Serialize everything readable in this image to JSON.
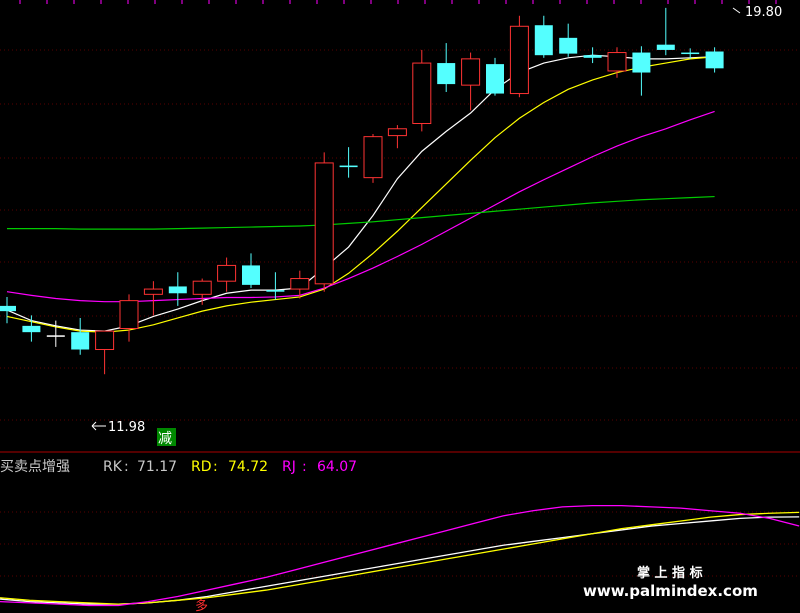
{
  "chart_data": [
    {
      "type": "candlestick",
      "title": "",
      "xlabel": "",
      "ylabel": "",
      "ylim": [
        11.5,
        20.1
      ],
      "grid": true,
      "annotations": {
        "high_label": "19.80",
        "low_label": "11.98",
        "signal_label": "减"
      },
      "candles": [
        {
          "o": 14.18,
          "h": 14.45,
          "l": 13.95,
          "c": 14.28,
          "color": "cyan"
        },
        {
          "o": 13.9,
          "h": 14.1,
          "l": 13.6,
          "c": 13.78,
          "color": "cyan"
        },
        {
          "o": 13.7,
          "h": 14.0,
          "l": 13.5,
          "c": 13.72,
          "color": "white"
        },
        {
          "o": 13.78,
          "h": 14.05,
          "l": 13.35,
          "c": 13.45,
          "color": "cyan"
        },
        {
          "o": 13.45,
          "h": 13.78,
          "l": 12.98,
          "c": 13.8,
          "color": "red"
        },
        {
          "o": 13.85,
          "h": 14.5,
          "l": 13.6,
          "c": 14.38,
          "color": "red"
        },
        {
          "o": 14.5,
          "h": 14.75,
          "l": 14.1,
          "c": 14.6,
          "color": "red"
        },
        {
          "o": 14.65,
          "h": 14.92,
          "l": 14.28,
          "c": 14.52,
          "color": "cyan"
        },
        {
          "o": 14.5,
          "h": 14.8,
          "l": 14.3,
          "c": 14.75,
          "color": "red"
        },
        {
          "o": 14.75,
          "h": 15.2,
          "l": 14.55,
          "c": 15.05,
          "color": "red"
        },
        {
          "o": 15.05,
          "h": 15.28,
          "l": 14.62,
          "c": 14.68,
          "color": "cyan"
        },
        {
          "o": 14.55,
          "h": 14.92,
          "l": 14.4,
          "c": 14.58,
          "color": "cyan"
        },
        {
          "o": 14.6,
          "h": 14.95,
          "l": 14.42,
          "c": 14.8,
          "color": "red"
        },
        {
          "o": 14.7,
          "h": 17.2,
          "l": 14.55,
          "c": 17.0,
          "color": "red"
        },
        {
          "o": 16.95,
          "h": 17.3,
          "l": 16.72,
          "c": 16.92,
          "color": "cyan"
        },
        {
          "o": 16.72,
          "h": 17.55,
          "l": 16.62,
          "c": 17.5,
          "color": "red"
        },
        {
          "o": 17.52,
          "h": 17.72,
          "l": 17.28,
          "c": 17.65,
          "color": "red"
        },
        {
          "o": 17.75,
          "h": 19.15,
          "l": 17.6,
          "c": 18.9,
          "color": "red"
        },
        {
          "o": 18.9,
          "h": 19.28,
          "l": 18.35,
          "c": 18.5,
          "color": "cyan"
        },
        {
          "o": 18.48,
          "h": 19.1,
          "l": 18.0,
          "c": 18.98,
          "color": "red"
        },
        {
          "o": 18.88,
          "h": 19.0,
          "l": 18.28,
          "c": 18.32,
          "color": "cyan"
        },
        {
          "o": 18.32,
          "h": 19.8,
          "l": 18.25,
          "c": 19.6,
          "color": "red"
        },
        {
          "o": 19.62,
          "h": 19.8,
          "l": 19.0,
          "c": 19.05,
          "color": "cyan"
        },
        {
          "o": 19.38,
          "h": 19.65,
          "l": 19.02,
          "c": 19.08,
          "color": "cyan"
        },
        {
          "o": 19.05,
          "h": 19.2,
          "l": 18.9,
          "c": 19.0,
          "color": "cyan"
        },
        {
          "o": 19.1,
          "h": 19.2,
          "l": 18.62,
          "c": 18.75,
          "color": "red"
        },
        {
          "o": 19.1,
          "h": 19.22,
          "l": 18.28,
          "c": 18.72,
          "color": "cyan"
        },
        {
          "o": 19.15,
          "h": 19.95,
          "l": 19.05,
          "c": 19.25,
          "color": "cyan"
        },
        {
          "o": 19.1,
          "h": 19.18,
          "l": 18.98,
          "c": 19.1,
          "color": "cyan"
        },
        {
          "o": 19.12,
          "h": 19.2,
          "l": 18.72,
          "c": 18.8,
          "color": "cyan"
        }
      ],
      "series": [
        {
          "color": "#ffffff",
          "values": [
            14.2,
            14.0,
            13.9,
            13.82,
            13.8,
            13.9,
            14.08,
            14.22,
            14.38,
            14.52,
            14.58,
            14.58,
            14.62,
            15.0,
            15.4,
            16.0,
            16.7,
            17.22,
            17.6,
            17.95,
            18.4,
            18.72,
            18.9,
            19.0,
            19.05,
            19.02,
            18.98,
            18.98,
            19.0,
            19.02
          ]
        },
        {
          "color": "#ffff00",
          "values": [
            14.08,
            13.98,
            13.88,
            13.8,
            13.78,
            13.82,
            13.92,
            14.05,
            14.18,
            14.28,
            14.35,
            14.4,
            14.45,
            14.6,
            14.9,
            15.28,
            15.7,
            16.15,
            16.6,
            17.05,
            17.48,
            17.85,
            18.15,
            18.4,
            18.58,
            18.72,
            18.82,
            18.9,
            18.98,
            19.02
          ]
        },
        {
          "color": "#ff00ff",
          "values": [
            14.55,
            14.48,
            14.42,
            14.38,
            14.36,
            14.36,
            14.38,
            14.4,
            14.42,
            14.44,
            14.44,
            14.45,
            14.48,
            14.62,
            14.8,
            15.0,
            15.22,
            15.45,
            15.7,
            15.95,
            16.2,
            16.45,
            16.68,
            16.9,
            17.12,
            17.32,
            17.5,
            17.65,
            17.82,
            17.98
          ]
        },
        {
          "color": "#00cc00",
          "values": [
            15.75,
            15.75,
            15.75,
            15.74,
            15.74,
            15.74,
            15.74,
            15.75,
            15.76,
            15.77,
            15.78,
            15.79,
            15.8,
            15.82,
            15.85,
            15.88,
            15.92,
            15.96,
            16.0,
            16.04,
            16.08,
            16.12,
            16.16,
            16.2,
            16.24,
            16.27,
            16.3,
            16.32,
            16.34,
            16.36
          ]
        }
      ]
    },
    {
      "type": "line",
      "title": "买卖点增强",
      "ylim": [
        0,
        100
      ],
      "annotations": {
        "signal_label": "多"
      },
      "series": [
        {
          "name": "RK",
          "color": "#ffffff",
          "last": "71.17",
          "values": [
            7,
            5,
            4,
            3,
            3,
            4,
            6,
            9,
            13,
            17,
            21,
            25,
            29,
            33,
            37,
            41,
            45,
            49,
            52,
            55,
            58,
            61,
            64,
            66,
            68,
            70,
            71,
            71.17
          ]
        },
        {
          "name": "RD",
          "color": "#ffff00",
          "last": "74.72",
          "values": [
            8,
            6,
            5,
            4,
            3,
            4,
            6,
            8,
            11,
            14,
            18,
            22,
            26,
            30,
            34,
            38,
            42,
            46,
            50,
            54,
            58,
            62,
            65,
            68,
            71,
            73,
            74,
            74.72
          ]
        },
        {
          "name": "RJ",
          "color": "#ff00ff",
          "last": "64.07",
          "values": [
            5,
            4,
            3,
            2,
            2,
            5,
            9,
            14,
            19,
            24,
            30,
            36,
            42,
            48,
            54,
            60,
            66,
            72,
            76,
            79,
            80,
            80,
            79,
            78,
            76,
            74,
            70,
            64.07
          ]
        }
      ]
    }
  ],
  "watermark": {
    "line1": "掌 上 指 标",
    "line2": "www.palmindex.com"
  }
}
